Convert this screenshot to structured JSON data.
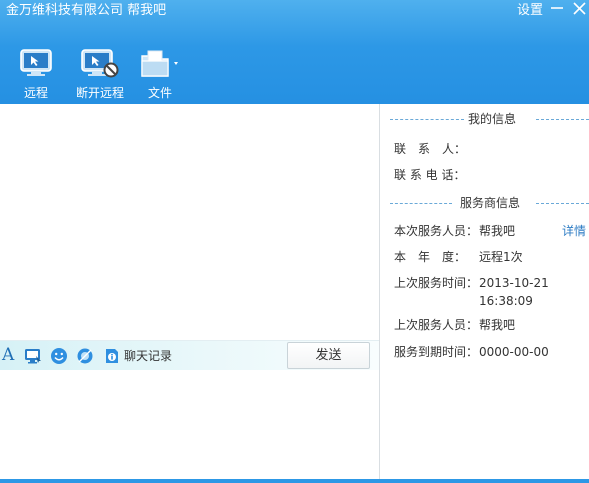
{
  "window": {
    "title": "金万维科技有限公司 帮我吧",
    "settings_label": "设置",
    "accent_color": "#2d98e6"
  },
  "toolbar": {
    "remote_label": "远程",
    "disconnect_label": "断开远程",
    "file_label": "文件"
  },
  "chat": {
    "tools": [
      "font-icon",
      "screenshot-icon",
      "emoji-icon",
      "shake-icon",
      "info-icon"
    ],
    "history_label": "聊天记录",
    "send_label": "发送",
    "font_glyph": "A"
  },
  "my_info": {
    "title": "我的信息",
    "contact_label": "联　系　人：",
    "contact_value": "",
    "phone_label": "联 系 电 话：",
    "phone_value": ""
  },
  "provider_info": {
    "title": "服务商信息",
    "detail_link": "详情",
    "rows": [
      {
        "label": "本次服务人员：",
        "value": "帮我吧"
      },
      {
        "label": "本　年　度：",
        "value": "远程1次"
      },
      {
        "label": "上次服务时间：",
        "value": "2013-10-21",
        "value2": "16:38:09"
      },
      {
        "label": "上次服务人员：",
        "value": "帮我吧"
      },
      {
        "label": "服务到期时间：",
        "value": "0000-00-00"
      }
    ]
  }
}
